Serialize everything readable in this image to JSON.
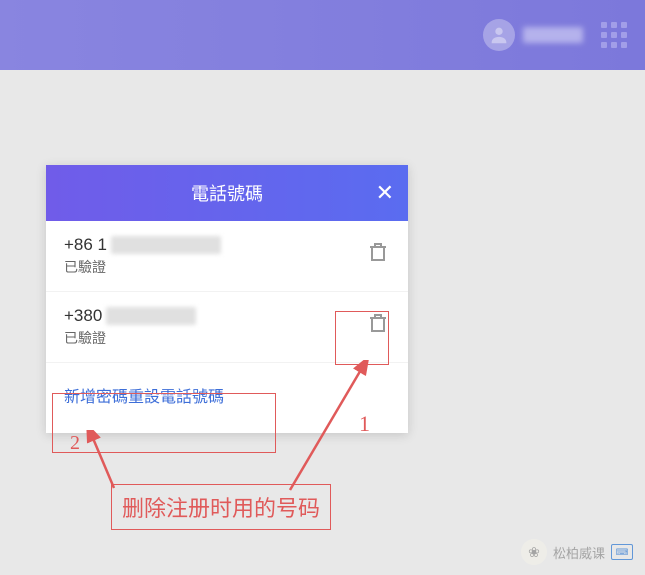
{
  "header": {
    "apps_icon": "apps-grid"
  },
  "modal": {
    "title": "電話號碼",
    "close_label": "✕",
    "phones": [
      {
        "prefix": "+86 1",
        "status": "已驗證"
      },
      {
        "prefix": "+380",
        "status": "已驗證"
      }
    ],
    "add_link": "新增密碼重設電話號碼"
  },
  "annotations": {
    "num1": "1",
    "num2": "2",
    "note": "删除注册时用的号码"
  },
  "watermark": {
    "text": "松柏威课"
  },
  "colors": {
    "accent_purple": "#705ce9",
    "annotation_red": "#e05a5a",
    "link_blue": "#3d6ed8"
  }
}
